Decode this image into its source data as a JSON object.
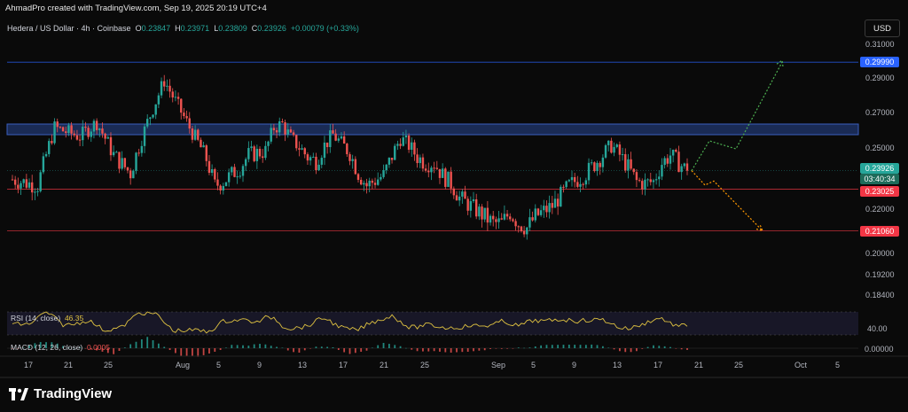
{
  "header": {
    "credit": "AhmadPro created with TradingView.com, Sep 19, 2025 20:19 UTC+4",
    "currency": "USD"
  },
  "legend": {
    "symbol": "Hedera / US Dollar · 4h · Coinbase",
    "o_label": "O",
    "o_value": "0.23847",
    "h_label": "H",
    "h_value": "0.23971",
    "l_label": "L",
    "l_value": "0.23809",
    "c_label": "C",
    "c_value": "0.23926",
    "change": "+0.00079 (+0.33%)"
  },
  "colors": {
    "up": "#26a69a",
    "down": "#ef5350",
    "zone": "#1a2b55",
    "zone_border": "#3a5fbf",
    "level_blue": "#2962ff",
    "level_red": "#f23645",
    "rsi": "#e0c341",
    "projection_up": "#4caf50",
    "projection_down": "#ff9800"
  },
  "chart_data": {
    "type": "candlestick",
    "price_axis_ticks": [
      "0.31000",
      "0.29000",
      "0.27000",
      "0.25000",
      "0.22000",
      "0.20000",
      "0.19200",
      "0.18400"
    ],
    "price_axis_values": [
      0.31,
      0.29,
      0.27,
      0.25,
      0.22,
      0.2,
      0.192,
      0.184
    ],
    "x_ticks": [
      "17",
      "21",
      "25",
      "Aug",
      "5",
      "9",
      "13",
      "17",
      "21",
      "25",
      "Sep",
      "5",
      "9",
      "13",
      "17",
      "21",
      "25",
      "Oct",
      "5"
    ],
    "levels": [
      {
        "value": 0.2999,
        "label": "0.29990",
        "color": "#2962ff"
      },
      {
        "value": 0.23025,
        "label": "0.23025",
        "color": "#f23645"
      },
      {
        "value": 0.2106,
        "label": "0.21060",
        "color": "#f23645"
      }
    ],
    "current": {
      "value": 0.23926,
      "label": "0.23926",
      "countdown": "03:40:34"
    },
    "resistance_zone": [
      0.258,
      0.264
    ],
    "path": [
      [
        0,
        0.235
      ],
      [
        3,
        0.232
      ],
      [
        5,
        0.262
      ],
      [
        8,
        0.257
      ],
      [
        10,
        0.265
      ],
      [
        12,
        0.247
      ],
      [
        14,
        0.238
      ],
      [
        16,
        0.265
      ],
      [
        18,
        0.289
      ],
      [
        19,
        0.28
      ],
      [
        21,
        0.262
      ],
      [
        23,
        0.245
      ],
      [
        24,
        0.232
      ],
      [
        25,
        0.234
      ],
      [
        27,
        0.241
      ],
      [
        28,
        0.247
      ],
      [
        30,
        0.249
      ],
      [
        31,
        0.262
      ],
      [
        32,
        0.264
      ],
      [
        33,
        0.256
      ],
      [
        35,
        0.246
      ],
      [
        36,
        0.244
      ],
      [
        37,
        0.252
      ],
      [
        38,
        0.258
      ],
      [
        40,
        0.248
      ],
      [
        41,
        0.238
      ],
      [
        42,
        0.232
      ],
      [
        44,
        0.237
      ],
      [
        46,
        0.256
      ],
      [
        47,
        0.252
      ],
      [
        48,
        0.246
      ],
      [
        49,
        0.243
      ],
      [
        50,
        0.243
      ],
      [
        51,
        0.237
      ],
      [
        52,
        0.233
      ],
      [
        53,
        0.226
      ],
      [
        55,
        0.22
      ],
      [
        57,
        0.214
      ],
      [
        58,
        0.214
      ],
      [
        59,
        0.219
      ],
      [
        60,
        0.214
      ],
      [
        61,
        0.212
      ],
      [
        62,
        0.217
      ],
      [
        64,
        0.222
      ],
      [
        66,
        0.232
      ],
      [
        68,
        0.238
      ],
      [
        70,
        0.247
      ],
      [
        71,
        0.252
      ],
      [
        72,
        0.247
      ],
      [
        73,
        0.241
      ],
      [
        74,
        0.234
      ],
      [
        75,
        0.233
      ],
      [
        76,
        0.234
      ],
      [
        77,
        0.243
      ],
      [
        78,
        0.247
      ],
      [
        79,
        0.243
      ],
      [
        80,
        0.2393
      ]
    ],
    "path_x_range": [
      0,
      80
    ],
    "projection_up": [
      [
        0.2393,
        0
      ],
      [
        0.2545,
        1
      ],
      [
        0.25,
        2
      ],
      [
        0.2999,
        3
      ]
    ],
    "projection_down": [
      [
        0.2393,
        0
      ],
      [
        0.2322,
        1
      ],
      [
        0.2342,
        2
      ],
      [
        0.2106,
        3
      ]
    ],
    "rsi": {
      "label": "RSI (14, close)",
      "value": "46.35",
      "level_label": "40.00"
    },
    "macd": {
      "label": "MACD (12, 26, close)",
      "value": "0.0005",
      "level_label": "0.00000"
    }
  }
}
